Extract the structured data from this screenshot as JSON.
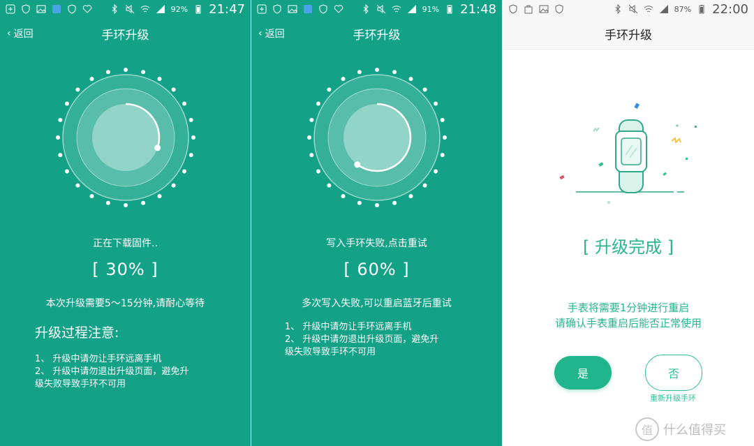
{
  "colors": {
    "teal": "#13a287",
    "accent": "#21b58c",
    "accent_light": "#2fbe95"
  },
  "panels": [
    {
      "status": {
        "battery": "92%",
        "time": "21:47"
      },
      "back_label": "返回",
      "title": "手环升级",
      "status_text": "正在下载固件..",
      "progress": 0.3,
      "percent_label": "[ 30% ]",
      "wait_text": "本次升级需要5～15分钟,请耐心等待",
      "notes_title": "升级过程注意:",
      "notes": [
        "1、 升级中请勿让手环远离手机",
        "2、 升级中请勿退出升级页面，避免升",
        "级失败导致手环不可用"
      ]
    },
    {
      "status": {
        "battery": "91%",
        "time": "21:48"
      },
      "back_label": "返回",
      "title": "手环升级",
      "status_text": "写入手环失败,点击重试",
      "progress": 0.6,
      "percent_label": "[ 60% ]",
      "wait_text": "多次写入失败,可以重启蓝牙后重试",
      "notes": [
        "1、 升级中请勿让手环远离手机",
        "2、 升级中请勿退出升级页面，避免升",
        "级失败导致手环不可用"
      ]
    },
    {
      "status": {
        "battery": "87%",
        "time": "22:00"
      },
      "title": "手环升级",
      "done_title": "[ 升级完成 ]",
      "restart_lines": [
        "手表将需要1分钟进行重启",
        "请确认手表重启后能否正常使用"
      ],
      "yes_label": "是",
      "no_label": "否",
      "no_sub": "重新升级手环"
    }
  ],
  "watermark": {
    "logo_glyph": "值",
    "text": "什么值得买"
  }
}
